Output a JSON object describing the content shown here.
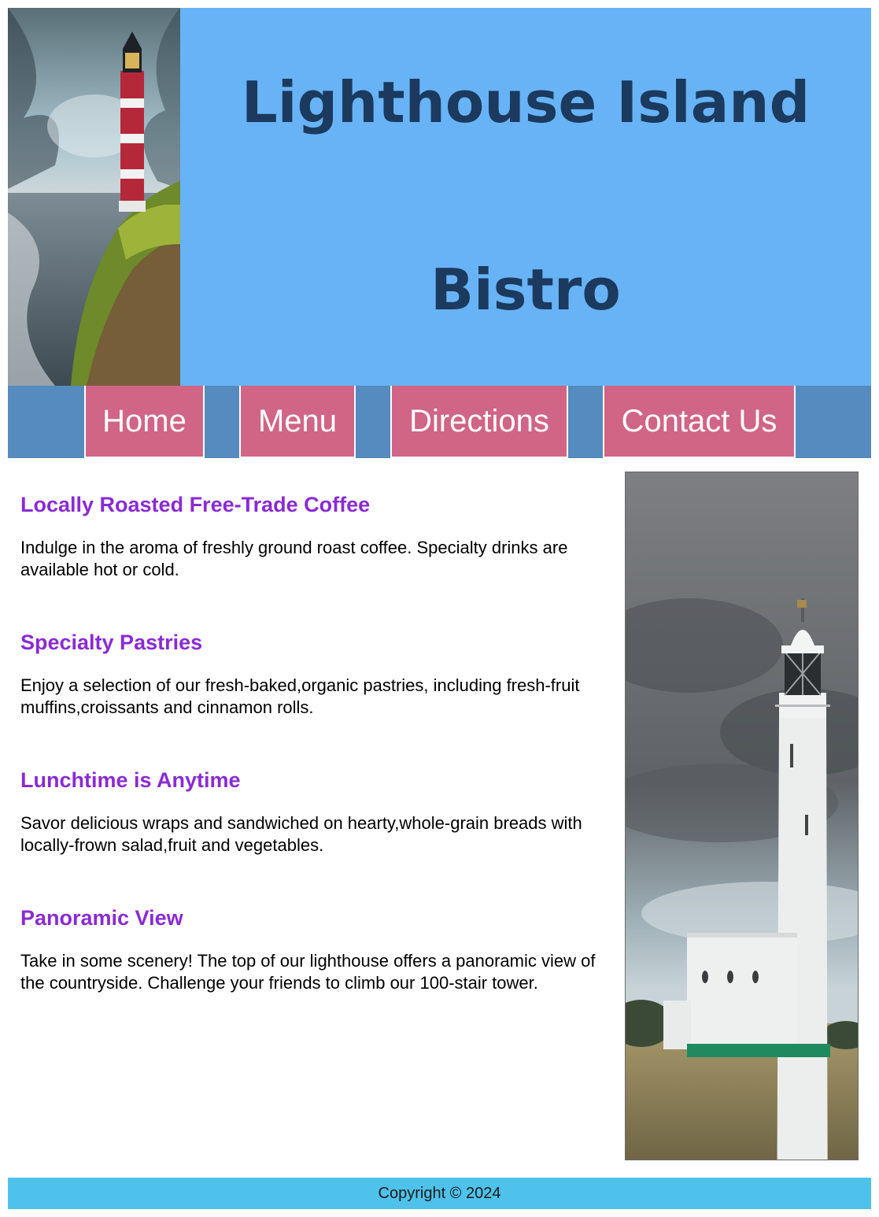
{
  "header": {
    "title_line1": "Lighthouse Island",
    "title_line2": "Bistro",
    "background": "#67b3f6",
    "title_color": "#1b3a5e"
  },
  "nav": {
    "items": [
      {
        "label": "Home"
      },
      {
        "label": "Menu"
      },
      {
        "label": "Directions"
      },
      {
        "label": "Contact Us"
      }
    ],
    "background": "#558bbe",
    "item_background": "#d06586"
  },
  "main": {
    "sections": [
      {
        "heading": "Locally Roasted Free-Trade Coffee",
        "text": "Indulge in the aroma of freshly ground roast coffee. Specialty drinks are available hot or cold."
      },
      {
        "heading": "Specialty Pastries",
        "text": "Enjoy a selection of our fresh-baked,organic pastries, including fresh-fruit muffins,croissants and cinnamon rolls."
      },
      {
        "heading": "Lunchtime is Anytime",
        "text": "Savor delicious wraps and sandwiched on hearty,whole-grain breads with locally-frown salad,fruit and vegetables."
      },
      {
        "heading": "Panoramic View",
        "text": "Take in some scenery! The top of our lighthouse offers a panoramic view of the countryside. Challenge your friends to climb our 100-stair tower."
      }
    ],
    "heading_color": "#8a2bd3"
  },
  "footer": {
    "text": "Copyright © 2024",
    "background": "#4fc2ec"
  }
}
